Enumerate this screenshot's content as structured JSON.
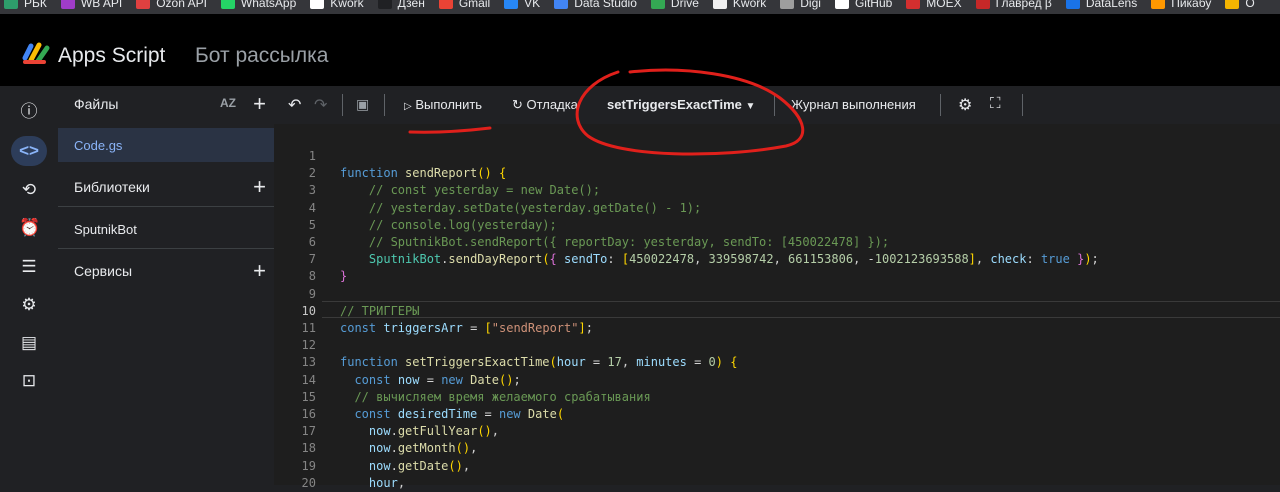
{
  "bookmarks": [
    "РЬК",
    "WB API",
    "Ozon API",
    "WhatsApp",
    "Kwork",
    "Дзен",
    "Gmail",
    "VK",
    "Data Studio",
    "Drive",
    "Kwork",
    "Digi",
    "GitHub",
    "MOEX",
    "Главред β",
    "DataLens",
    "Пикабу",
    "O"
  ],
  "bookmark_colors": [
    "#2e9e6b",
    "#a03cc8",
    "#e04040",
    "#25d366",
    "#ffffff",
    "#202124",
    "#ea4335",
    "#2787f5",
    "#4285f4",
    "#34a853",
    "#f0f0f0",
    "#9e9e9e",
    "#ffffff",
    "#d32f2f",
    "#c62828",
    "#1a73e8",
    "#ff9800",
    "#f4b400"
  ],
  "app": {
    "title": "Apps Script",
    "project": "Бот рассылка"
  },
  "sidebar": {
    "files_label": "Файлы",
    "sort_label": "AZ",
    "file": "Code.gs",
    "libraries_label": "Библиотеки",
    "library": "SputnikBot",
    "services_label": "Сервисы"
  },
  "toolbar": {
    "run_label": "Выполнить",
    "debug_label": "Отладка",
    "function_label": "setTriggersExactTime",
    "log_label": "Журнал выполнения"
  },
  "rail_icons": [
    "info-icon",
    "code-icon",
    "history-icon",
    "alarm-icon",
    "executions-icon",
    "settings-icon",
    "deployments-icon",
    "embed-icon"
  ],
  "editor": {
    "current_line": 10,
    "lines": [
      "",
      "function sendReport() {",
      "    // const yesterday = new Date();",
      "    // yesterday.setDate(yesterday.getDate() - 1);",
      "    // console.log(yesterday);",
      "    // SputnikBot.sendReport({ reportDay: yesterday, sendTo: [450022478] });",
      "    SputnikBot.sendDayReport({ sendTo: [450022478, 339598742, 661153806, -1002123693588], check: true });",
      "}",
      "",
      "// ТРИГГЕРЫ",
      "const triggersArr = [\"sendReport\"];",
      "",
      "function setTriggersExactTime(hour = 17, minutes = 0) {",
      "  const now = new Date();",
      "  // вычисляем время желаемого срабатывания",
      "  const desiredTime = new Date(",
      "    now.getFullYear(),",
      "    now.getMonth(),",
      "    now.getDate(),",
      "    hour,"
    ]
  },
  "colors": {
    "accent": "#8ab4f8",
    "annotation": "#e0201b"
  }
}
